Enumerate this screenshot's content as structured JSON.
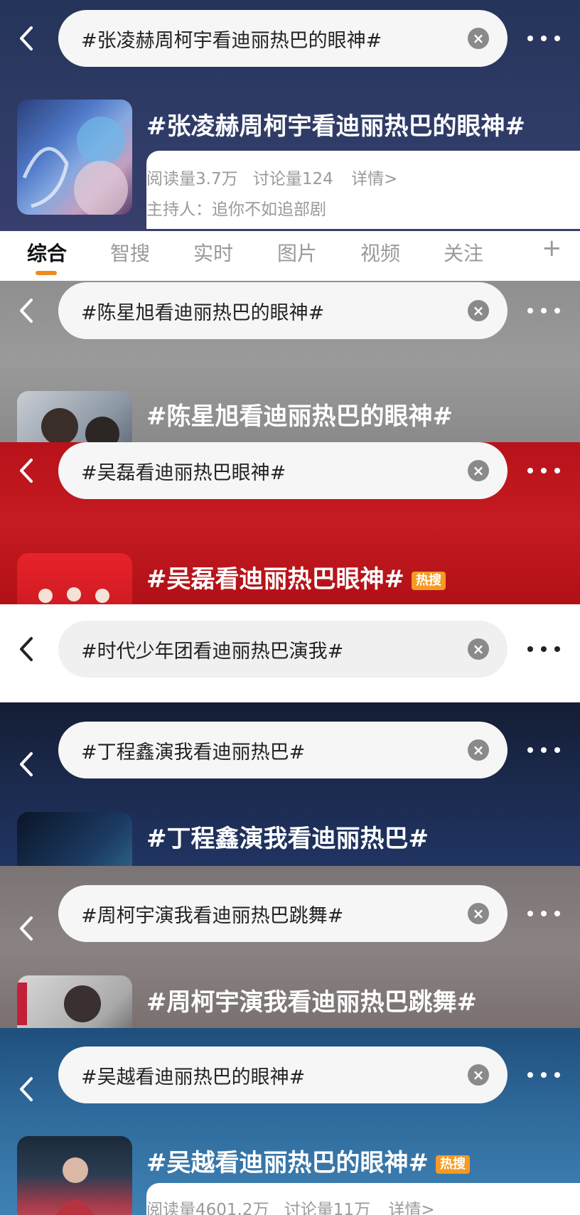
{
  "panels": [
    {
      "query": "#张凌赫周柯宇看迪丽热巴的眼神#",
      "title": "#张凌赫周柯宇看迪丽热巴的眼神#",
      "reads": "阅读量3.7万",
      "discussions": "讨论量124",
      "details": "详情>",
      "host": "主持人：追你不如追部剧"
    },
    {
      "query": "#陈星旭看迪丽热巴的眼神#",
      "title": "#陈星旭看迪丽热巴的眼神#"
    },
    {
      "query": "#吴磊看迪丽热巴眼神#",
      "title": "#吴磊看迪丽热巴眼神#",
      "badge": "热搜"
    },
    {
      "query": "#时代少年团看迪丽热巴演我#"
    },
    {
      "query": "#丁程鑫演我看迪丽热巴#",
      "title": "#丁程鑫演我看迪丽热巴#"
    },
    {
      "query": "#周柯宇演我看迪丽热巴跳舞#",
      "title": "#周柯宇演我看迪丽热巴跳舞#"
    },
    {
      "query": "#吴越看迪丽热巴的眼神#",
      "title": "#吴越看迪丽热巴的眼神#",
      "badge": "热搜",
      "reads": "阅读量4601.2万",
      "discussions": "讨论量11万",
      "details": "详情>"
    }
  ],
  "tabs": [
    "综合",
    "智搜",
    "实时",
    "图片",
    "视频",
    "关注"
  ],
  "tab_add": "+",
  "clear_symbol": "×",
  "colors": {
    "accent": "#f08a1c",
    "hot_badge": "#f59a23"
  },
  "icons": {
    "back": "chevron-left-icon",
    "clear": "clear-icon",
    "more": "more-dots-icon"
  }
}
